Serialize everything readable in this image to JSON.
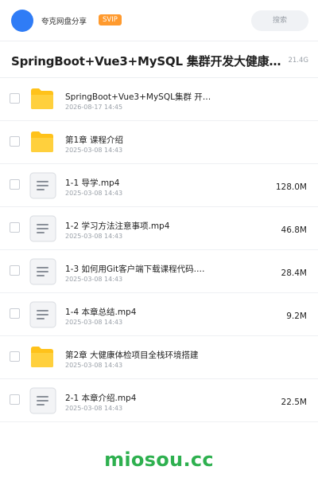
{
  "header": {
    "app_name": "夸克网盘分享",
    "badge": "SVIP",
    "search_label": "搜索"
  },
  "folder": {
    "title": "SpringBoot+Vue3+MySQL 集群开发大健康体检…",
    "size": "21.4G"
  },
  "items": [
    {
      "type": "folder",
      "name": "SpringBoot+Vue3+MySQL集群 开…",
      "date": "2026-08-17 14:45",
      "size": ""
    },
    {
      "type": "folder",
      "name": "第1章 课程介绍",
      "date": "2025-03-08 14:43",
      "size": ""
    },
    {
      "type": "file",
      "name": "1-1 导学.mp4",
      "date": "2025-03-08 14:43",
      "size": "128.0M"
    },
    {
      "type": "file",
      "name": "1-2 学习方法注意事项.mp4",
      "date": "2025-03-08 14:43",
      "size": "46.8M"
    },
    {
      "type": "file",
      "name": "1-3 如何用Git客户端下载课程代码.mp4",
      "date": "2025-03-08 14:43",
      "size": "28.4M"
    },
    {
      "type": "file",
      "name": "1-4 本章总结.mp4",
      "date": "2025-03-08 14:43",
      "size": "9.2M"
    },
    {
      "type": "folder",
      "name": "第2章 大健康体检项目全栈环境搭建",
      "date": "2025-03-08 14:43",
      "size": ""
    },
    {
      "type": "file",
      "name": "2-1 本章介绍.mp4",
      "date": "2025-03-08 14:43",
      "size": "22.5M"
    }
  ],
  "watermark": "miosou.cc",
  "colors": {
    "accent": "#2f7cf6",
    "badge": "#ff9a2e",
    "folder": "#ffc21a",
    "watermark": "#2eb04f"
  },
  "icons": {
    "folder": "folder-icon",
    "file": "video-file-icon"
  }
}
